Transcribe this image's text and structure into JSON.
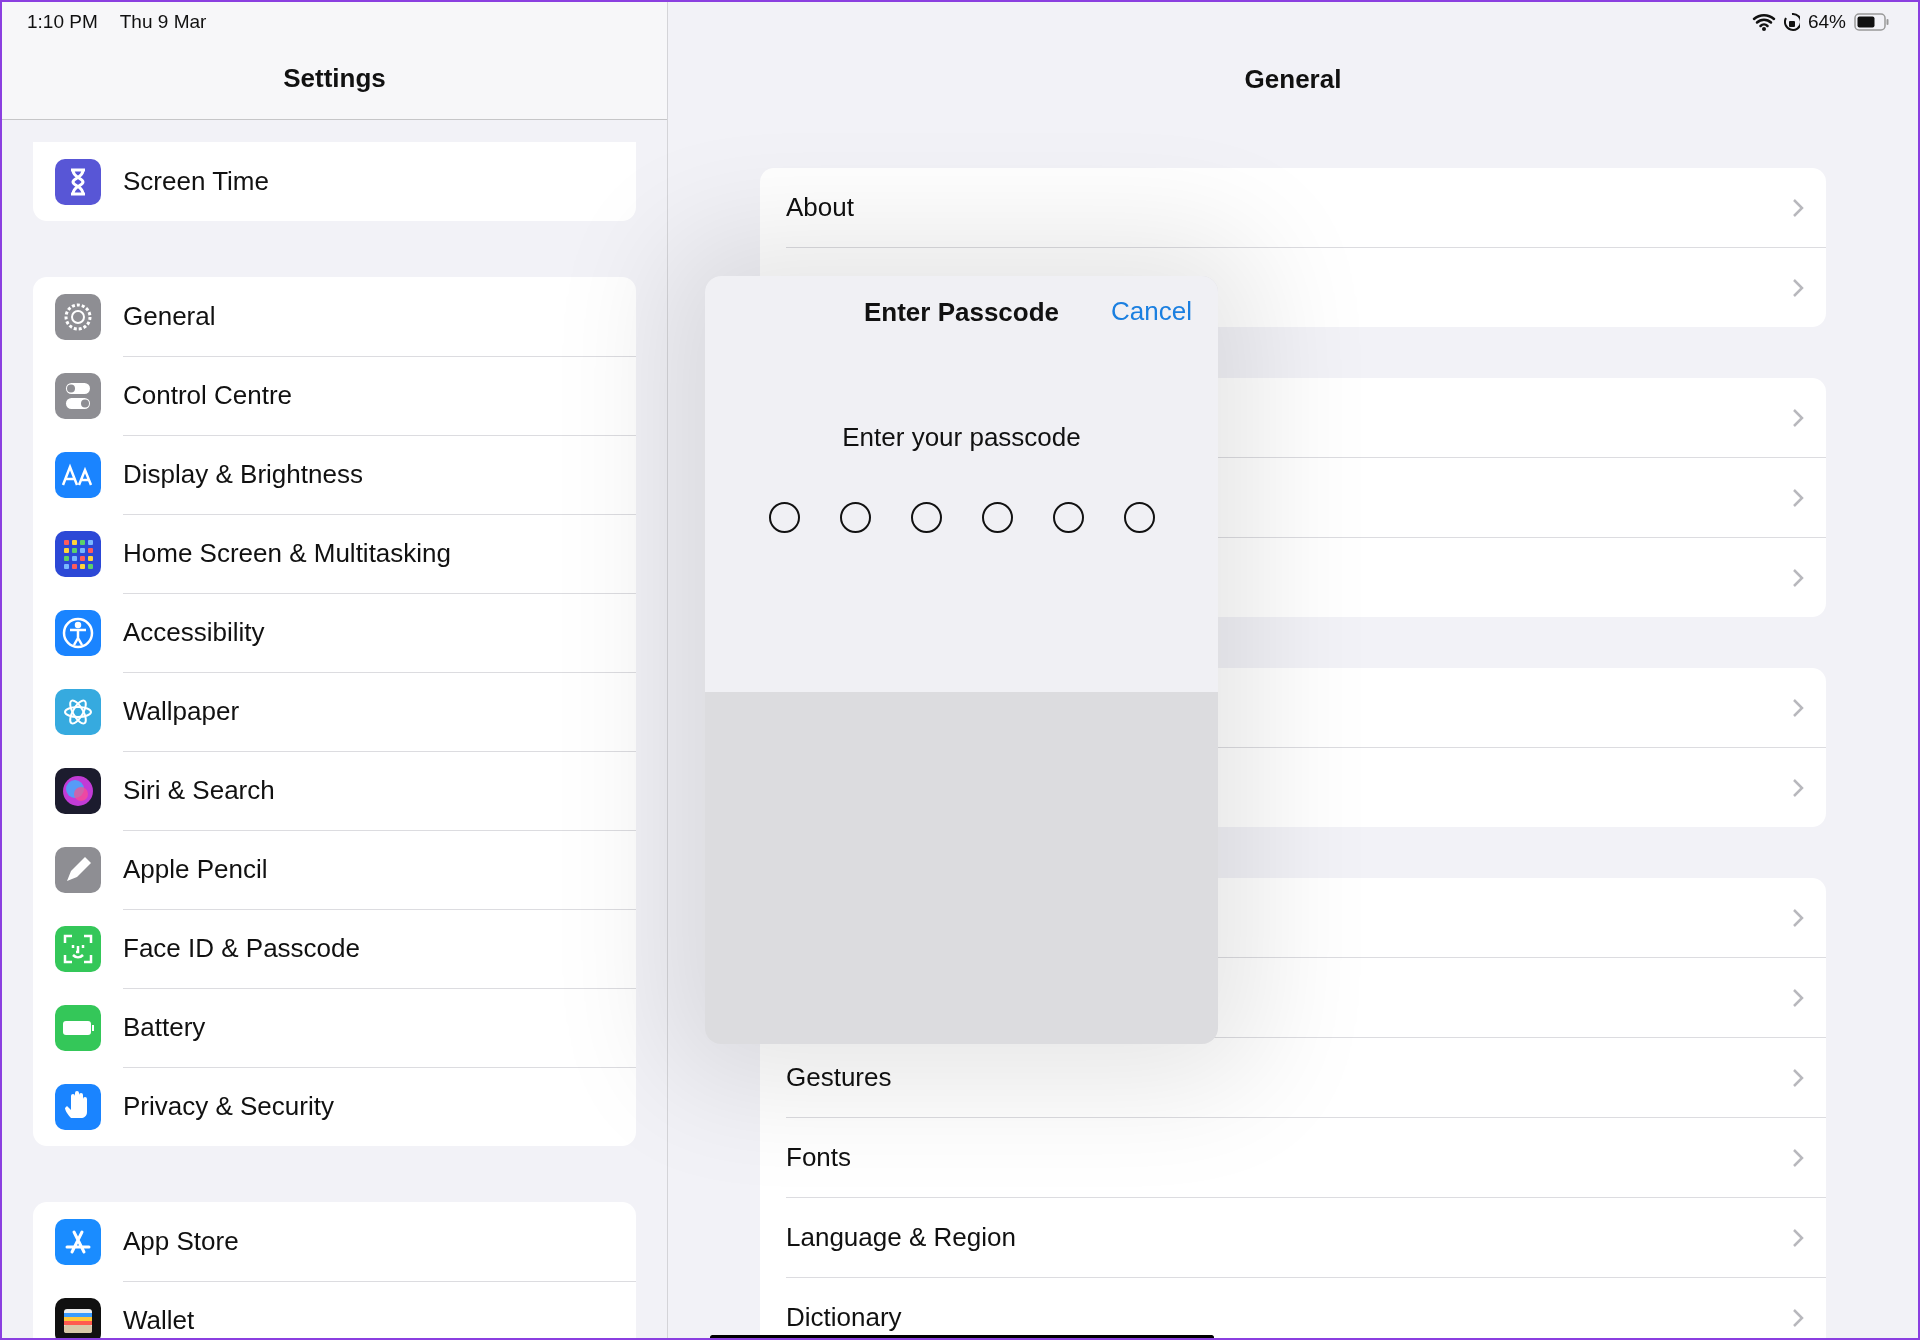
{
  "status_bar": {
    "time": "1:10 PM",
    "date": "Thu 9 Mar",
    "battery": "64%"
  },
  "sidebar": {
    "title": "Settings",
    "groups": [
      {
        "items": [
          {
            "label": "Screen Time"
          }
        ]
      },
      {
        "items": [
          {
            "label": "General",
            "selected": false
          },
          {
            "label": "Control Centre",
            "selected": false
          },
          {
            "label": "Display & Brightness",
            "selected": false
          },
          {
            "label": "Home Screen & Multitasking",
            "selected": false
          },
          {
            "label": "Accessibility",
            "selected": false
          },
          {
            "label": "Wallpaper",
            "selected": false
          },
          {
            "label": "Siri & Search",
            "selected": false
          },
          {
            "label": "Apple Pencil",
            "selected": false
          },
          {
            "label": "Face ID & Passcode",
            "selected": false
          },
          {
            "label": "Battery",
            "selected": false
          },
          {
            "label": "Privacy & Security",
            "selected": false
          }
        ]
      },
      {
        "items": [
          {
            "label": "App Store",
            "selected": false
          },
          {
            "label": "Wallet",
            "selected": false
          }
        ]
      }
    ]
  },
  "detail": {
    "title": "General",
    "groups": [
      {
        "rows": [
          "About",
          null
        ]
      },
      {
        "rows": [
          null,
          null,
          null
        ]
      },
      {
        "rows": [
          null,
          null
        ]
      },
      {
        "rows": [
          null,
          null,
          "Gestures",
          "Fonts",
          "Language & Region",
          "Dictionary"
        ]
      }
    ]
  },
  "dialog": {
    "title": "Enter Passcode",
    "cancel": "Cancel",
    "prompt": "Enter your passcode",
    "dots": [
      {
        "filled": false
      },
      {
        "filled": false
      },
      {
        "filled": false
      },
      {
        "filled": false
      },
      {
        "filled": false
      },
      {
        "filled": false
      }
    ]
  }
}
